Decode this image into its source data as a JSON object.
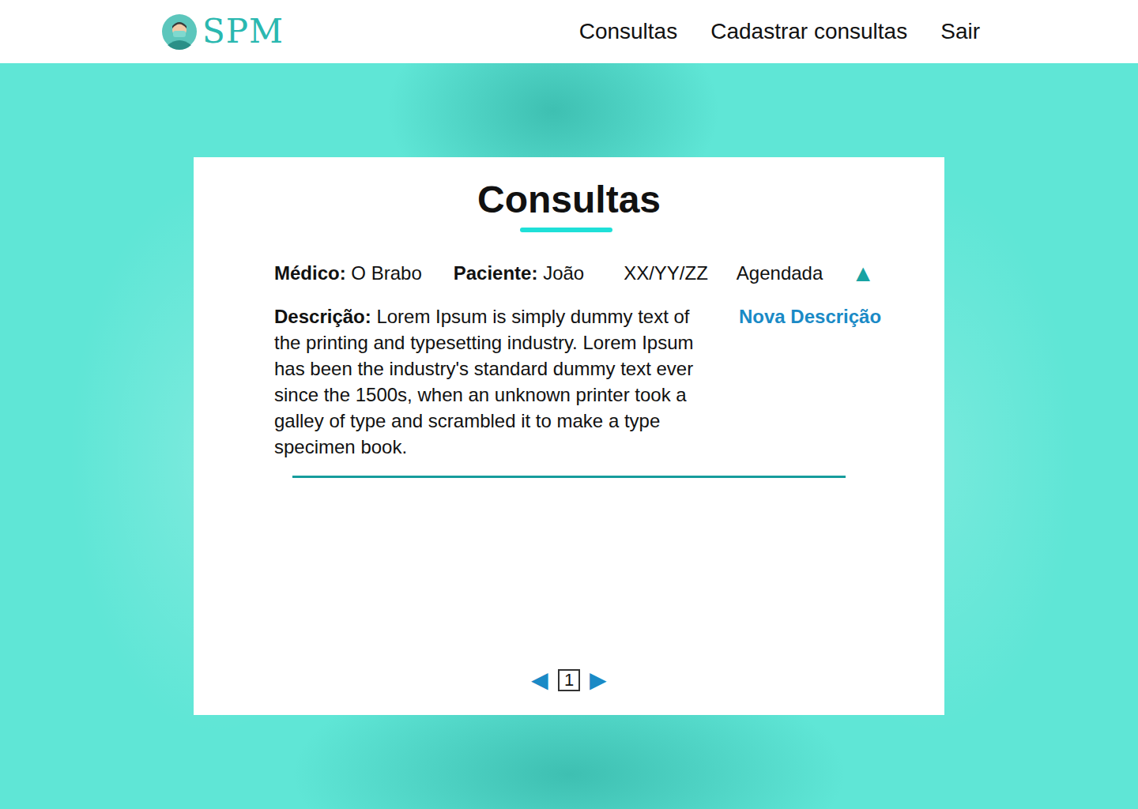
{
  "header": {
    "logo": "SPM",
    "nav": [
      {
        "label": "Consultas"
      },
      {
        "label": "Cadastrar consultas"
      },
      {
        "label": "Sair"
      }
    ]
  },
  "page": {
    "title": "Consultas"
  },
  "consultations": [
    {
      "doctor_label": "Médico:",
      "doctor": "O Brabo",
      "patient_label": "Paciente:",
      "patient": "João",
      "date": "XX/YY/ZZ",
      "status": "Agendada",
      "toggle": "▲",
      "expanded": true,
      "description_label": "Descrição:",
      "description": "Lorem Ipsum is simply dummy text of the printing and typesetting industry. Lorem Ipsum has been the industry's standard dummy text ever since the 1500s, when an unknown printer took a galley of type and scrambled it to make a type specimen book.",
      "action": "Nova Descrição"
    }
  ],
  "pagination": {
    "prev": "◀",
    "page": "1",
    "next": "▶"
  }
}
